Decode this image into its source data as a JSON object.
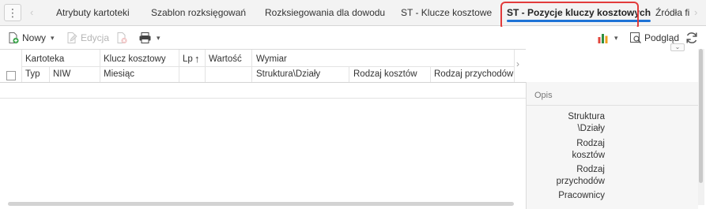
{
  "tabs": {
    "more_menu_icon": "kebab-icon",
    "items": [
      {
        "label": "Atrybuty kartoteki"
      },
      {
        "label": "Szablon rozksięgowań"
      },
      {
        "label": "Rozksiegowania dla dowodu"
      },
      {
        "label": "ST - Klucze kosztowe"
      },
      {
        "label": "ST - Pozycje kluczy kosztowych",
        "active": true
      },
      {
        "label": "Źródła fi"
      }
    ]
  },
  "toolbar": {
    "new_label": "Nowy",
    "edit_label": "Edycja",
    "preview_label": "Podgląd"
  },
  "grid": {
    "header_row1": {
      "kartoteka": "Kartoteka",
      "klucz": "Klucz kosztowy",
      "lp": "Lp",
      "wartosc": "Wartość",
      "wymiar": "Wymiar"
    },
    "header_row2": {
      "typ": "Typ",
      "niw": "NIW",
      "miesiac": "Miesiąc",
      "struktura": "Struktura\\Działy",
      "rodzaj_kosztow": "Rodzaj kosztów",
      "rodzaj_przychodow": "Rodzaj przychodów"
    },
    "sort_icon": "sort-up-icon"
  },
  "panel": {
    "title": "Opis",
    "labels": [
      "Struktura\n\\Działy",
      "Rodzaj\nkosztów",
      "Rodzaj\nprzychodów",
      "Pracownicy"
    ]
  },
  "colors": {
    "accent": "#1e73d6",
    "highlight": "#e23b3b"
  }
}
